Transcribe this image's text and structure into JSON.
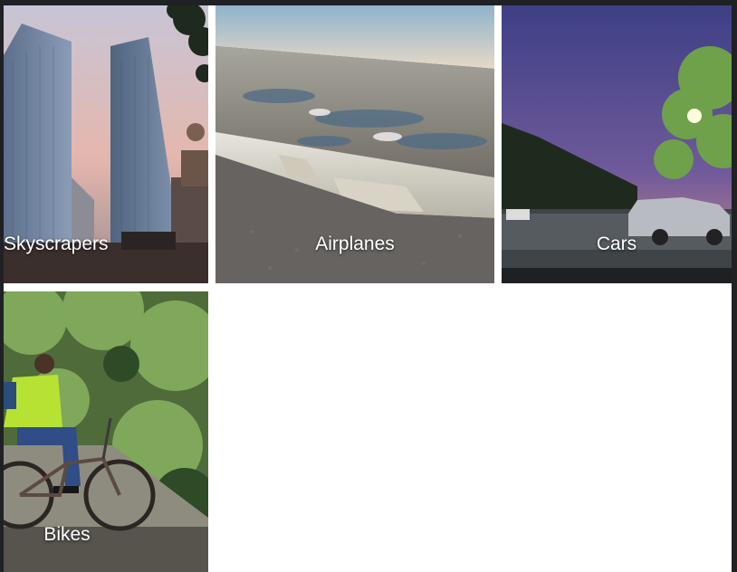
{
  "gallery": {
    "tiles": [
      {
        "label": "Skyscrapers"
      },
      {
        "label": "Airplanes"
      },
      {
        "label": "Cars"
      },
      {
        "label": "Bikes"
      }
    ]
  }
}
